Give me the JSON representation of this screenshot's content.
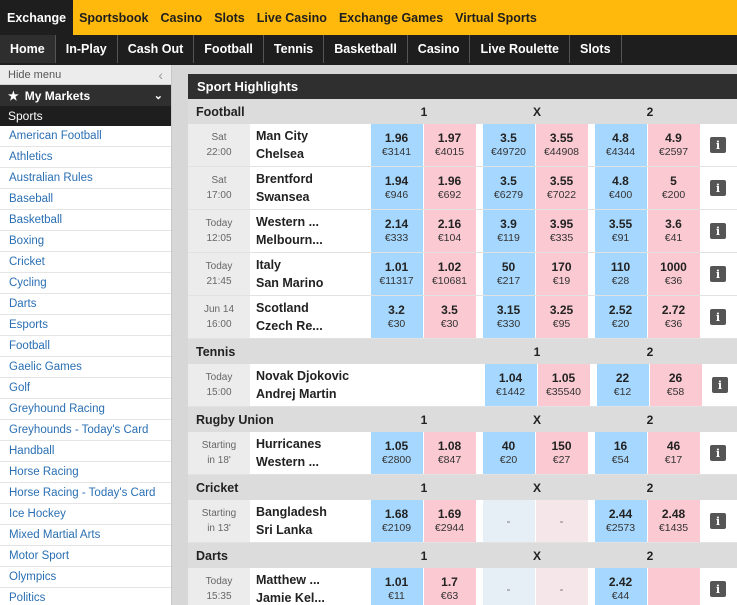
{
  "top_nav": [
    "Exchange",
    "Sportsbook",
    "Casino",
    "Slots",
    "Live Casino",
    "Exchange Games",
    "Virtual Sports"
  ],
  "sub_nav": [
    "Home",
    "In-Play",
    "Cash Out",
    "Football",
    "Tennis",
    "Basketball",
    "Casino",
    "Live Roulette",
    "Slots"
  ],
  "sidebar": {
    "hide_menu": "Hide menu",
    "my_markets": "My Markets",
    "sports_heading": "Sports",
    "items": [
      "American Football",
      "Athletics",
      "Australian Rules",
      "Baseball",
      "Basketball",
      "Boxing",
      "Cricket",
      "Cycling",
      "Darts",
      "Esports",
      "Football",
      "Gaelic Games",
      "Golf",
      "Greyhound Racing",
      "Greyhounds - Today's Card",
      "Handball",
      "Horse Racing",
      "Horse Racing - Today's Card",
      "Ice Hockey",
      "Mixed Martial Arts",
      "Motor Sport",
      "Olympics",
      "Politics"
    ]
  },
  "main": {
    "title": "Sport Highlights",
    "sections": [
      {
        "name": "Football",
        "h1": "1",
        "hx": "X",
        "h2": "2",
        "rows": [
          {
            "day": "Sat",
            "time": "22:00",
            "team1": "Man City",
            "team2": "Chelsea",
            "odds": [
              [
                "1.96",
                "€3141"
              ],
              [
                "1.97",
                "€4015"
              ],
              [
                "3.5",
                "€49720"
              ],
              [
                "3.55",
                "€44908"
              ],
              [
                "4.8",
                "€4344"
              ],
              [
                "4.9",
                "€2597"
              ]
            ]
          },
          {
            "day": "Sat",
            "time": "17:00",
            "team1": "Brentford",
            "team2": "Swansea",
            "odds": [
              [
                "1.94",
                "€946"
              ],
              [
                "1.96",
                "€692"
              ],
              [
                "3.5",
                "€6279"
              ],
              [
                "3.55",
                "€7022"
              ],
              [
                "4.8",
                "€400"
              ],
              [
                "5",
                "€200"
              ]
            ]
          },
          {
            "day": "Today",
            "time": "12:05",
            "team1": "Western ...",
            "team2": "Melbourn...",
            "odds": [
              [
                "2.14",
                "€333"
              ],
              [
                "2.16",
                "€104"
              ],
              [
                "3.9",
                "€119"
              ],
              [
                "3.95",
                "€335"
              ],
              [
                "3.55",
                "€91"
              ],
              [
                "3.6",
                "€41"
              ]
            ]
          },
          {
            "day": "Today",
            "time": "21:45",
            "team1": "Italy",
            "team2": "San Marino",
            "odds": [
              [
                "1.01",
                "€11317"
              ],
              [
                "1.02",
                "€10681"
              ],
              [
                "50",
                "€217"
              ],
              [
                "170",
                "€19"
              ],
              [
                "110",
                "€28"
              ],
              [
                "1000",
                "€36"
              ]
            ]
          },
          {
            "day": "Jun 14",
            "time": "16:00",
            "team1": "Scotland",
            "team2": "Czech Re...",
            "odds": [
              [
                "3.2",
                "€30"
              ],
              [
                "3.5",
                "€30"
              ],
              [
                "3.15",
                "€330"
              ],
              [
                "3.25",
                "€95"
              ],
              [
                "2.52",
                "€20"
              ],
              [
                "2.72",
                "€36"
              ]
            ]
          }
        ]
      },
      {
        "name": "Tennis",
        "h1": "1",
        "hx": "",
        "h2": "2",
        "rows": [
          {
            "day": "Today",
            "time": "15:00",
            "team1": "Novak Djokovic",
            "team2": "Andrej Martin",
            "odds": [
              [
                "1.04",
                "€1442"
              ],
              [
                "1.05",
                "€35540"
              ],
              [
                "22",
                "€12"
              ],
              [
                "26",
                "€58"
              ]
            ]
          }
        ]
      },
      {
        "name": "Rugby Union",
        "h1": "1",
        "hx": "X",
        "h2": "2",
        "rows": [
          {
            "day": "Starting",
            "time": "in 18'",
            "team1": "Hurricanes",
            "team2": "Western ...",
            "odds": [
              [
                "1.05",
                "€2800"
              ],
              [
                "1.08",
                "€847"
              ],
              [
                "40",
                "€20"
              ],
              [
                "150",
                "€27"
              ],
              [
                "16",
                "€54"
              ],
              [
                "46",
                "€17"
              ]
            ]
          }
        ]
      },
      {
        "name": "Cricket",
        "h1": "1",
        "hx": "X",
        "h2": "2",
        "rows": [
          {
            "day": "Starting",
            "time": "in 13'",
            "team1": "Bangladesh",
            "team2": "Sri Lanka",
            "odds": [
              [
                "1.68",
                "€2109"
              ],
              [
                "1.69",
                "€2944"
              ],
              [
                "-",
                ""
              ],
              [
                "-",
                ""
              ],
              [
                "2.44",
                "€2573"
              ],
              [
                "2.48",
                "€1435"
              ]
            ]
          }
        ]
      },
      {
        "name": "Darts",
        "h1": "1",
        "hx": "X",
        "h2": "2",
        "rows": [
          {
            "day": "Today",
            "time": "15:35",
            "team1": "Matthew ...",
            "team2": "Jamie Kel...",
            "odds": [
              [
                "1.01",
                "€11"
              ],
              [
                "1.7",
                "€63"
              ],
              [
                "-",
                ""
              ],
              [
                "-",
                ""
              ],
              [
                "2.42",
                "€44"
              ],
              [
                "",
                ""
              ]
            ]
          }
        ]
      }
    ]
  },
  "colors": {
    "brand_yellow": "#ffb80c",
    "back_blue": "#a6d8ff",
    "lay_pink": "#fac9d1",
    "dark": "#1e1e1e"
  },
  "icons": {
    "info": "info-icon",
    "star": "star-icon",
    "collapse": "chevron-left-icon",
    "dropdown": "chevron-down-icon"
  }
}
